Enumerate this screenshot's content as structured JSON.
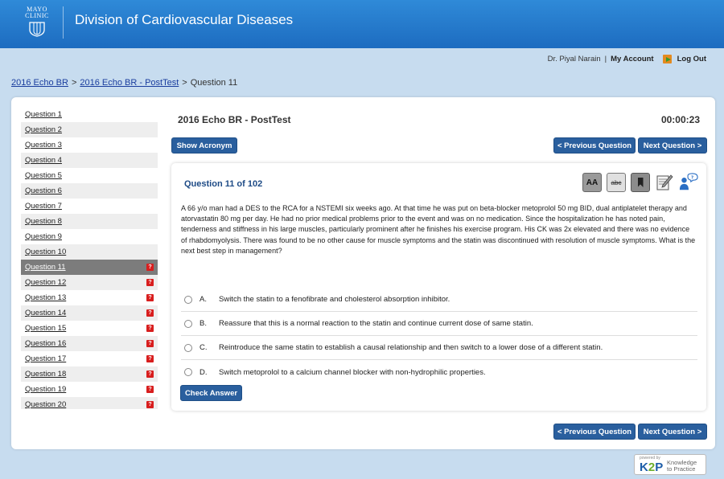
{
  "header": {
    "logo_line1": "MAYO",
    "logo_line2": "CLINIC",
    "title": "Division of Cardiovascular Diseases"
  },
  "user": {
    "name": "Dr. Piyal Narain",
    "separator": "|",
    "account": "My Account",
    "logout": "Log Out"
  },
  "breadcrumb": {
    "items": [
      "2016 Echo BR",
      "2016 Echo BR - PostTest"
    ],
    "current": "Question 11",
    "sep": ">"
  },
  "sidebar": {
    "questions": [
      {
        "label": "Question 1",
        "flag": ""
      },
      {
        "label": "Question 2",
        "flag": ""
      },
      {
        "label": "Question 3",
        "flag": ""
      },
      {
        "label": "Question 4",
        "flag": ""
      },
      {
        "label": "Question 5",
        "flag": ""
      },
      {
        "label": "Question 6",
        "flag": ""
      },
      {
        "label": "Question 7",
        "flag": ""
      },
      {
        "label": "Question 8",
        "flag": ""
      },
      {
        "label": "Question 9",
        "flag": ""
      },
      {
        "label": "Question 10",
        "flag": ""
      },
      {
        "label": "Question 11",
        "flag": "?"
      },
      {
        "label": "Question 12",
        "flag": "?"
      },
      {
        "label": "Question 13",
        "flag": "?"
      },
      {
        "label": "Question 14",
        "flag": "?"
      },
      {
        "label": "Question 15",
        "flag": "?"
      },
      {
        "label": "Question 16",
        "flag": "?"
      },
      {
        "label": "Question 17",
        "flag": "?"
      },
      {
        "label": "Question 18",
        "flag": "?"
      },
      {
        "label": "Question 19",
        "flag": "?"
      },
      {
        "label": "Question 20",
        "flag": "?"
      }
    ],
    "active_index": 10,
    "flag_color": "#d81e1e"
  },
  "test": {
    "title": "2016 Echo BR - PostTest",
    "timer": "00:00:23",
    "show_acronym": "Show Acronym",
    "prev": "< Previous Question",
    "next": "Next Question >"
  },
  "question": {
    "number": "Question 11 of 102",
    "stem": "A 66 y/o man had a DES to the RCA for a NSTEMI six weeks ago. At that time he was put on beta-blocker metoprolol 50 mg BID, dual antiplatelet therapy and atorvastatin 80 mg per day. He had no prior medical problems prior to the event and was on no medication. Since the hospitalization he has noted pain, tenderness and stiffness in his large muscles, particularly prominent after he finishes his exercise program. His CK was 2x elevated and there was no evidence of rhabdomyolysis. There was found to be no other cause for muscle symptoms and the statin was discontinued with resolution of muscle symptoms. What is the next best step in management?",
    "tools": {
      "font": "AA",
      "strike": "abc"
    },
    "answers": [
      {
        "letter": "A.",
        "text": "Switch the statin to a fenofibrate and cholesterol absorption inhibitor."
      },
      {
        "letter": "B.",
        "text": "Reassure that this is a normal reaction to the statin and continue current dose of same statin."
      },
      {
        "letter": "C.",
        "text": "Reintroduce the same statin to establish a causal relationship and then switch to a lower dose of a different statin."
      },
      {
        "letter": "D.",
        "text": "Switch metoprolol to a calcium channel blocker with non-hydrophilic properties."
      }
    ],
    "check": "Check Answer"
  },
  "footer": {
    "powered": "powered by",
    "k2p_k": "K",
    "k2p_2": "2",
    "k2p_p": "P",
    "k2p_line1": "Knowledge",
    "k2p_line2": "to Practice"
  }
}
